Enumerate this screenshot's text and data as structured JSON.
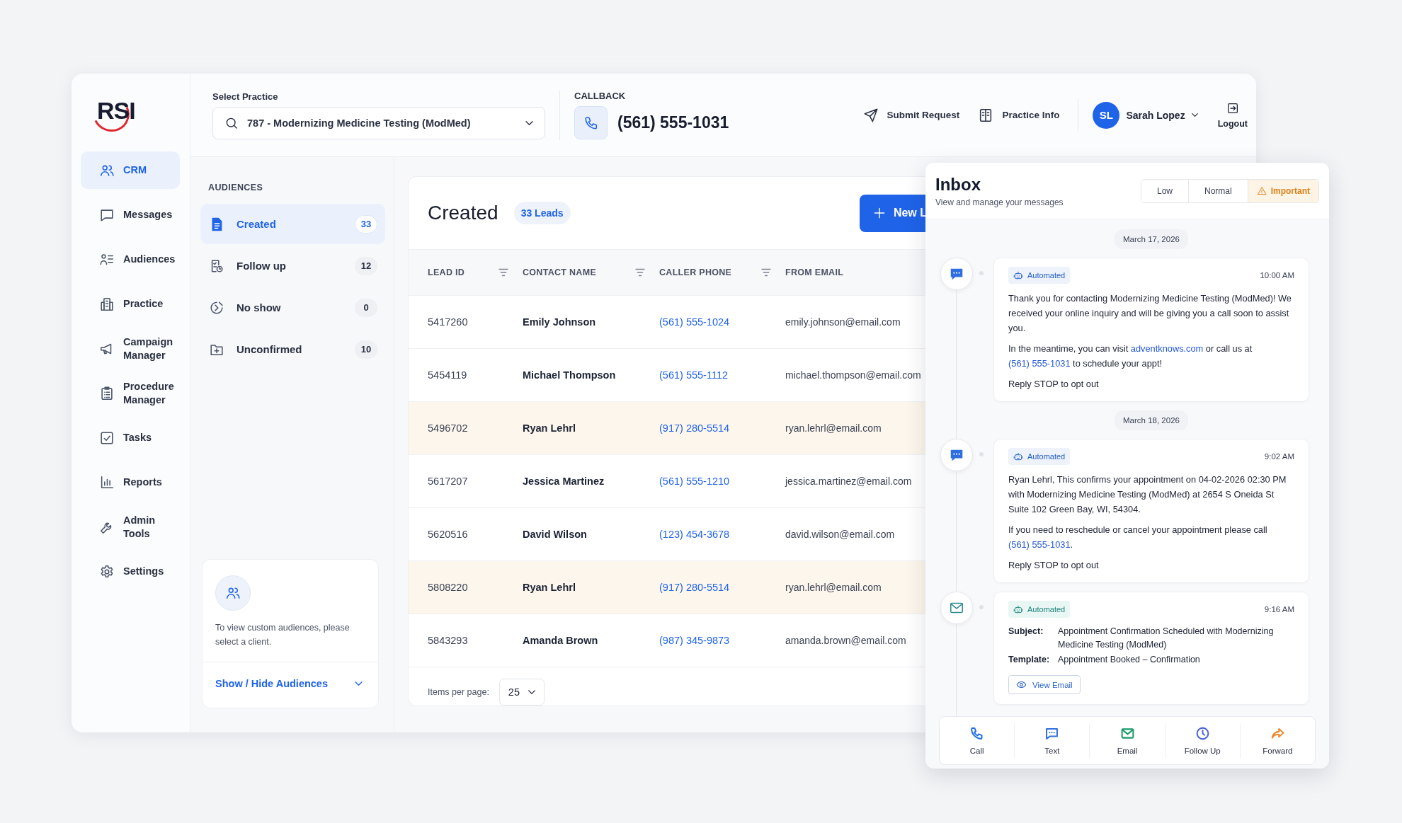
{
  "logo": "RSI",
  "sidebar": [
    {
      "label": "CRM",
      "kind": "users",
      "selected": true
    },
    {
      "label": "Messages",
      "kind": "chat",
      "selected": false
    },
    {
      "label": "Audiences",
      "kind": "audience",
      "selected": false
    },
    {
      "label": "Practice",
      "kind": "building",
      "selected": false
    },
    {
      "label": "Campaign Manager",
      "kind": "megaphone",
      "selected": false
    },
    {
      "label": "Procedure Manager",
      "kind": "clipboard",
      "selected": false
    },
    {
      "label": "Tasks",
      "kind": "checkbox",
      "selected": false
    },
    {
      "label": "Reports",
      "kind": "chart",
      "selected": false
    },
    {
      "label": "Admin Tools",
      "kind": "wrench",
      "selected": false
    },
    {
      "label": "Settings",
      "kind": "gear",
      "selected": false
    }
  ],
  "top_bar": {
    "practice_label": "Select Practice",
    "practice_value": "787 - Modernizing Medicine Testing (ModMed)",
    "callback_label": "CALLBACK",
    "callback_number": "(561) 555-1031",
    "actions": [
      {
        "label": "Submit Request",
        "kind": "send"
      },
      {
        "label": "Practice Info",
        "kind": "book"
      }
    ],
    "user": {
      "initials": "SL",
      "name": "Sarah Lopez"
    },
    "logout": "Logout"
  },
  "audiences": {
    "title": "AUDIENCES",
    "items": [
      {
        "label": "Created",
        "count": "33",
        "kind": "doc",
        "selected": true
      },
      {
        "label": "Follow up",
        "count": "12",
        "kind": "followup",
        "selected": false
      },
      {
        "label": "No show",
        "count": "0",
        "kind": "noshow",
        "selected": false
      },
      {
        "label": "Unconfirmed",
        "count": "10",
        "kind": "folder",
        "selected": false
      }
    ],
    "notice": {
      "text": "To view custom audiences, please select a client.",
      "toggle": "Show / Hide Audiences"
    }
  },
  "leads": {
    "title": "Created",
    "count_badge": "33 Leads",
    "new_button": "New L",
    "columns": [
      {
        "label": "LEAD ID",
        "filter": true
      },
      {
        "label": "CONTACT NAME",
        "filter": true
      },
      {
        "label": "CALLER PHONE",
        "filter": true
      },
      {
        "label": "FROM EMAIL",
        "filter": false
      }
    ],
    "rows": [
      {
        "cells": [
          "5417260",
          "Emily Johnson",
          "(561) 555-1024",
          "emily.johnson@email.com"
        ],
        "highlighted": false
      },
      {
        "cells": [
          "5454119",
          "Michael Thompson",
          "(561) 555-1112",
          "michael.thompson@email.com"
        ],
        "highlighted": false
      },
      {
        "cells": [
          "5496702",
          "Ryan Lehrl",
          "(917) 280-5514",
          "ryan.lehrl@email.com"
        ],
        "highlighted": true
      },
      {
        "cells": [
          "5617207",
          "Jessica Martinez",
          "(561) 555-1210",
          "jessica.martinez@email.com"
        ],
        "highlighted": false
      },
      {
        "cells": [
          "5620516",
          "David Wilson",
          "(123) 454-3678",
          "david.wilson@email.com"
        ],
        "highlighted": false
      },
      {
        "cells": [
          "5808220",
          "Ryan Lehrl",
          "(917) 280-5514",
          "ryan.lehrl@email.com"
        ],
        "highlighted": true
      },
      {
        "cells": [
          "5843293",
          "Amanda Brown",
          "(987) 345-9873",
          "amanda.brown@email.com"
        ],
        "highlighted": false
      }
    ],
    "pagination": {
      "label": "Items per page:",
      "value": "25"
    }
  },
  "inbox": {
    "title": "Inbox",
    "subtitle": "View and manage your messages",
    "priorities": [
      {
        "label": "Low",
        "kind": "plain",
        "selected": false
      },
      {
        "label": "Normal",
        "kind": "plain",
        "selected": false
      },
      {
        "label": "Important",
        "kind": "warning",
        "selected": true
      }
    ],
    "timeline": [
      {
        "kind": "date",
        "label": "March 17, 2026"
      },
      {
        "kind": "sms",
        "tag": "Automated",
        "time": "10:00 AM",
        "paragraphs": [
          [
            {
              "kind": "text",
              "t": "Thank you for contacting Modernizing Medicine Testing (ModMed)! We received your online inquiry and will be giving you a call soon to assist you."
            }
          ],
          [
            {
              "kind": "text",
              "t": "In the meantime, you can visit "
            },
            {
              "kind": "link",
              "t": "adventknows.com"
            },
            {
              "kind": "text",
              "t": " or call us at "
            },
            {
              "kind": "link",
              "t": "(561) 555-1031"
            },
            {
              "kind": "text",
              "t": " to schedule your appt!"
            }
          ],
          [
            {
              "kind": "text",
              "t": "Reply STOP to opt out"
            }
          ]
        ]
      },
      {
        "kind": "date",
        "label": "March 18, 2026"
      },
      {
        "kind": "sms",
        "tag": "Automated",
        "time": "9:02 AM",
        "paragraphs": [
          [
            {
              "kind": "text",
              "t": "Ryan Lehrl, This confirms your appointment on 04-02-2026 02:30 PM with Modernizing Medicine Testing (ModMed) at 2654 S Oneida St Suite 102 Green Bay, WI, 54304."
            }
          ],
          [
            {
              "kind": "text",
              "t": "If you need to reschedule or cancel your appointment please call "
            },
            {
              "kind": "link",
              "t": "(561) 555-1031"
            },
            {
              "kind": "text",
              "t": "."
            }
          ],
          [
            {
              "kind": "text",
              "t": "Reply STOP to opt out"
            }
          ]
        ]
      },
      {
        "kind": "email",
        "tag": "Automated",
        "time": "9:16 AM",
        "fields": [
          {
            "label": "Subject:",
            "value": "Appointment Confirmation Scheduled with Modernizing Medicine Testing (ModMed)"
          },
          {
            "label": "Template:",
            "value": "Appointment Booked – Confirmation"
          }
        ],
        "button": "View Email"
      }
    ],
    "actions": [
      {
        "label": "Call",
        "kind": "phone",
        "color": "#1f6fe5"
      },
      {
        "label": "Text",
        "kind": "chat",
        "color": "#2f6ee0"
      },
      {
        "label": "Email",
        "kind": "mail",
        "color": "#179a6a"
      },
      {
        "label": "Follow Up",
        "kind": "clock",
        "color": "#4c63d8"
      },
      {
        "label": "Forward",
        "kind": "forward",
        "color": "#e8892c"
      }
    ]
  }
}
